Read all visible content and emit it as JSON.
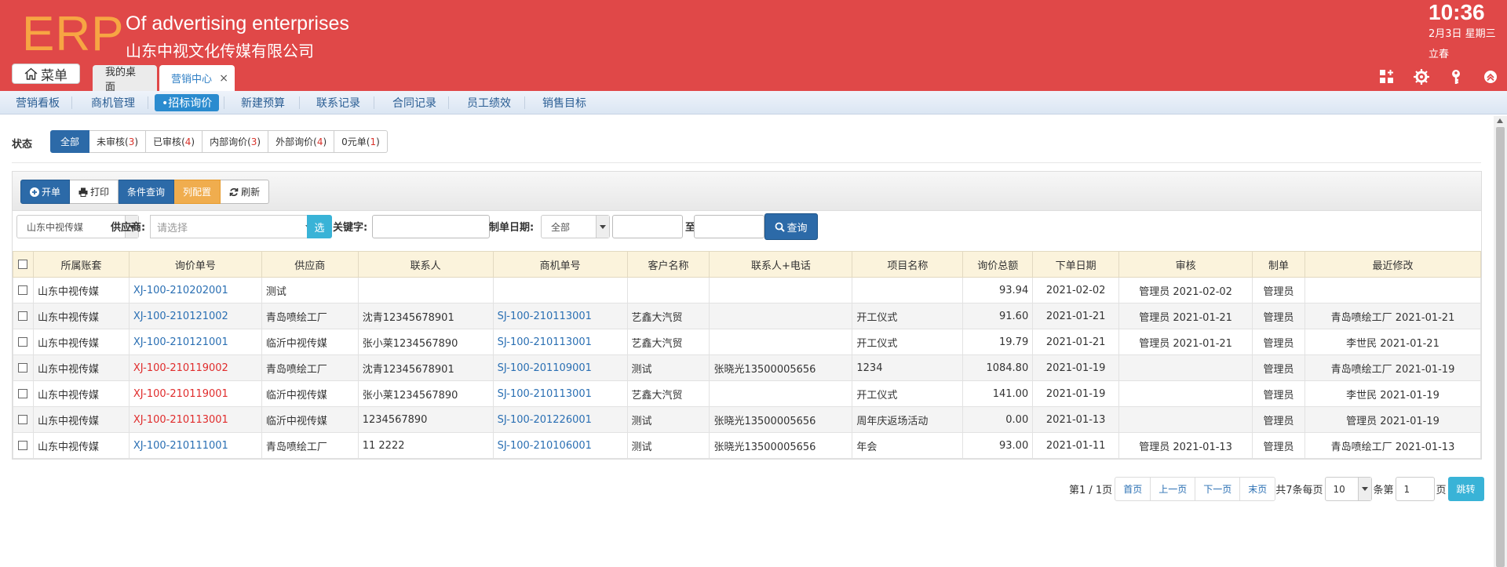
{
  "header": {
    "logo": "ERP",
    "subtitle_en": "Of advertising enterprises",
    "subtitle_cn": "山东中视文化传媒有限公司",
    "time": "10:36",
    "date": "2月3日 星期三",
    "solar_term": "立春",
    "menu_label": "菜单",
    "tabs": [
      {
        "label": "我的桌面"
      },
      {
        "label": "营销中心",
        "close": "×"
      }
    ]
  },
  "subnav": {
    "items": [
      {
        "label": "营销看板"
      },
      {
        "label": "商机管理"
      },
      {
        "label": "•招标询价"
      },
      {
        "label": "新建预算"
      },
      {
        "label": "联系记录"
      },
      {
        "label": "合同记录"
      },
      {
        "label": "员工绩效"
      },
      {
        "label": "销售目标"
      }
    ]
  },
  "status": {
    "label": "状态",
    "filters": [
      {
        "label": "全部",
        "count": ""
      },
      {
        "label": "未审核",
        "count": "3"
      },
      {
        "label": "已审核",
        "count": "4"
      },
      {
        "label": "内部询价",
        "count": "3"
      },
      {
        "label": "外部询价",
        "count": "4"
      },
      {
        "label": "0元单",
        "count": "1"
      }
    ]
  },
  "toolbar": {
    "new_label": "开单",
    "print_label": "打印",
    "query_label": "条件查询",
    "column_label": "列配置",
    "refresh_label": "刷新"
  },
  "search": {
    "account_value": "山东中视传媒",
    "supplier_label": "供应商:",
    "supplier_placeholder": "请选择",
    "select_btn": "选",
    "keyword_label": "关键字:",
    "keyword_value": "",
    "date_label": "制单日期:",
    "date_range_value": "全部",
    "to_label": "至",
    "query_btn": "查询"
  },
  "table": {
    "columns": [
      "所属账套",
      "询价单号",
      "供应商",
      "联系人",
      "商机单号",
      "客户名称",
      "联系人+电话",
      "项目名称",
      "询价总额",
      "下单日期",
      "审核",
      "制单",
      "最近修改"
    ],
    "rows": [
      [
        "山东中视传媒",
        "XJ-100-210202001",
        "测试",
        "",
        "",
        "",
        "",
        "",
        "93.94",
        "2021-02-02",
        "管理员 2021-02-02",
        "管理员",
        ""
      ],
      [
        "山东中视传媒",
        "XJ-100-210121002",
        "青岛喷绘工厂",
        "沈青12345678901",
        "SJ-100-210113001",
        "艺鑫大汽贸",
        "",
        "开工仪式",
        "91.60",
        "2021-01-21",
        "管理员 2021-01-21",
        "管理员",
        "青岛喷绘工厂 2021-01-21"
      ],
      [
        "山东中视传媒",
        "XJ-100-210121001",
        "临沂中视传媒",
        "张小莱1234567890",
        "SJ-100-210113001",
        "艺鑫大汽贸",
        "",
        "开工仪式",
        "19.79",
        "2021-01-21",
        "管理员 2021-01-21",
        "管理员",
        "李世民 2021-01-21"
      ],
      [
        "山东中视传媒",
        "XJ-100-210119002",
        "青岛喷绘工厂",
        "沈青12345678901",
        "SJ-100-201109001",
        "测试",
        "张晓光13500005656",
        "1234",
        "1084.80",
        "2021-01-19",
        "",
        "管理员",
        "青岛喷绘工厂 2021-01-19"
      ],
      [
        "山东中视传媒",
        "XJ-100-210119001",
        "临沂中视传媒",
        "张小莱1234567890",
        "SJ-100-210113001",
        "艺鑫大汽贸",
        "",
        "开工仪式",
        "141.00",
        "2021-01-19",
        "",
        "管理员",
        "李世民 2021-01-19"
      ],
      [
        "山东中视传媒",
        "XJ-100-210113001",
        "临沂中视传媒",
        "1234567890",
        "SJ-100-201226001",
        "测试",
        "张晓光13500005656",
        "周年庆返场活动",
        "0.00",
        "2021-01-13",
        "",
        "管理员",
        "管理员 2021-01-19"
      ],
      [
        "山东中视传媒",
        "XJ-100-210111001",
        "青岛喷绘工厂",
        "11 2222",
        "SJ-100-210106001",
        "测试",
        "张晓光13500005656",
        "年会",
        "93.00",
        "2021-01-11",
        "管理员 2021-01-13",
        "管理员",
        "青岛喷绘工厂 2021-01-13"
      ]
    ]
  },
  "pager": {
    "page_info": "第1 / 1页",
    "first": "首页",
    "prev": "上一页",
    "next": "下一页",
    "last": "末页",
    "total_text": "共7条每页",
    "page_size": "10",
    "per_text": "条第",
    "page_num": "1",
    "page_unit": "页",
    "go": "跳转"
  },
  "colors": {
    "header_bg": "#e04848",
    "logo": "#f7a543",
    "primary": "#2c6aa8",
    "info": "#39b3d7",
    "warning": "#f0ad4e",
    "link": "#2a6fb3",
    "alert": "#e02c2c"
  }
}
